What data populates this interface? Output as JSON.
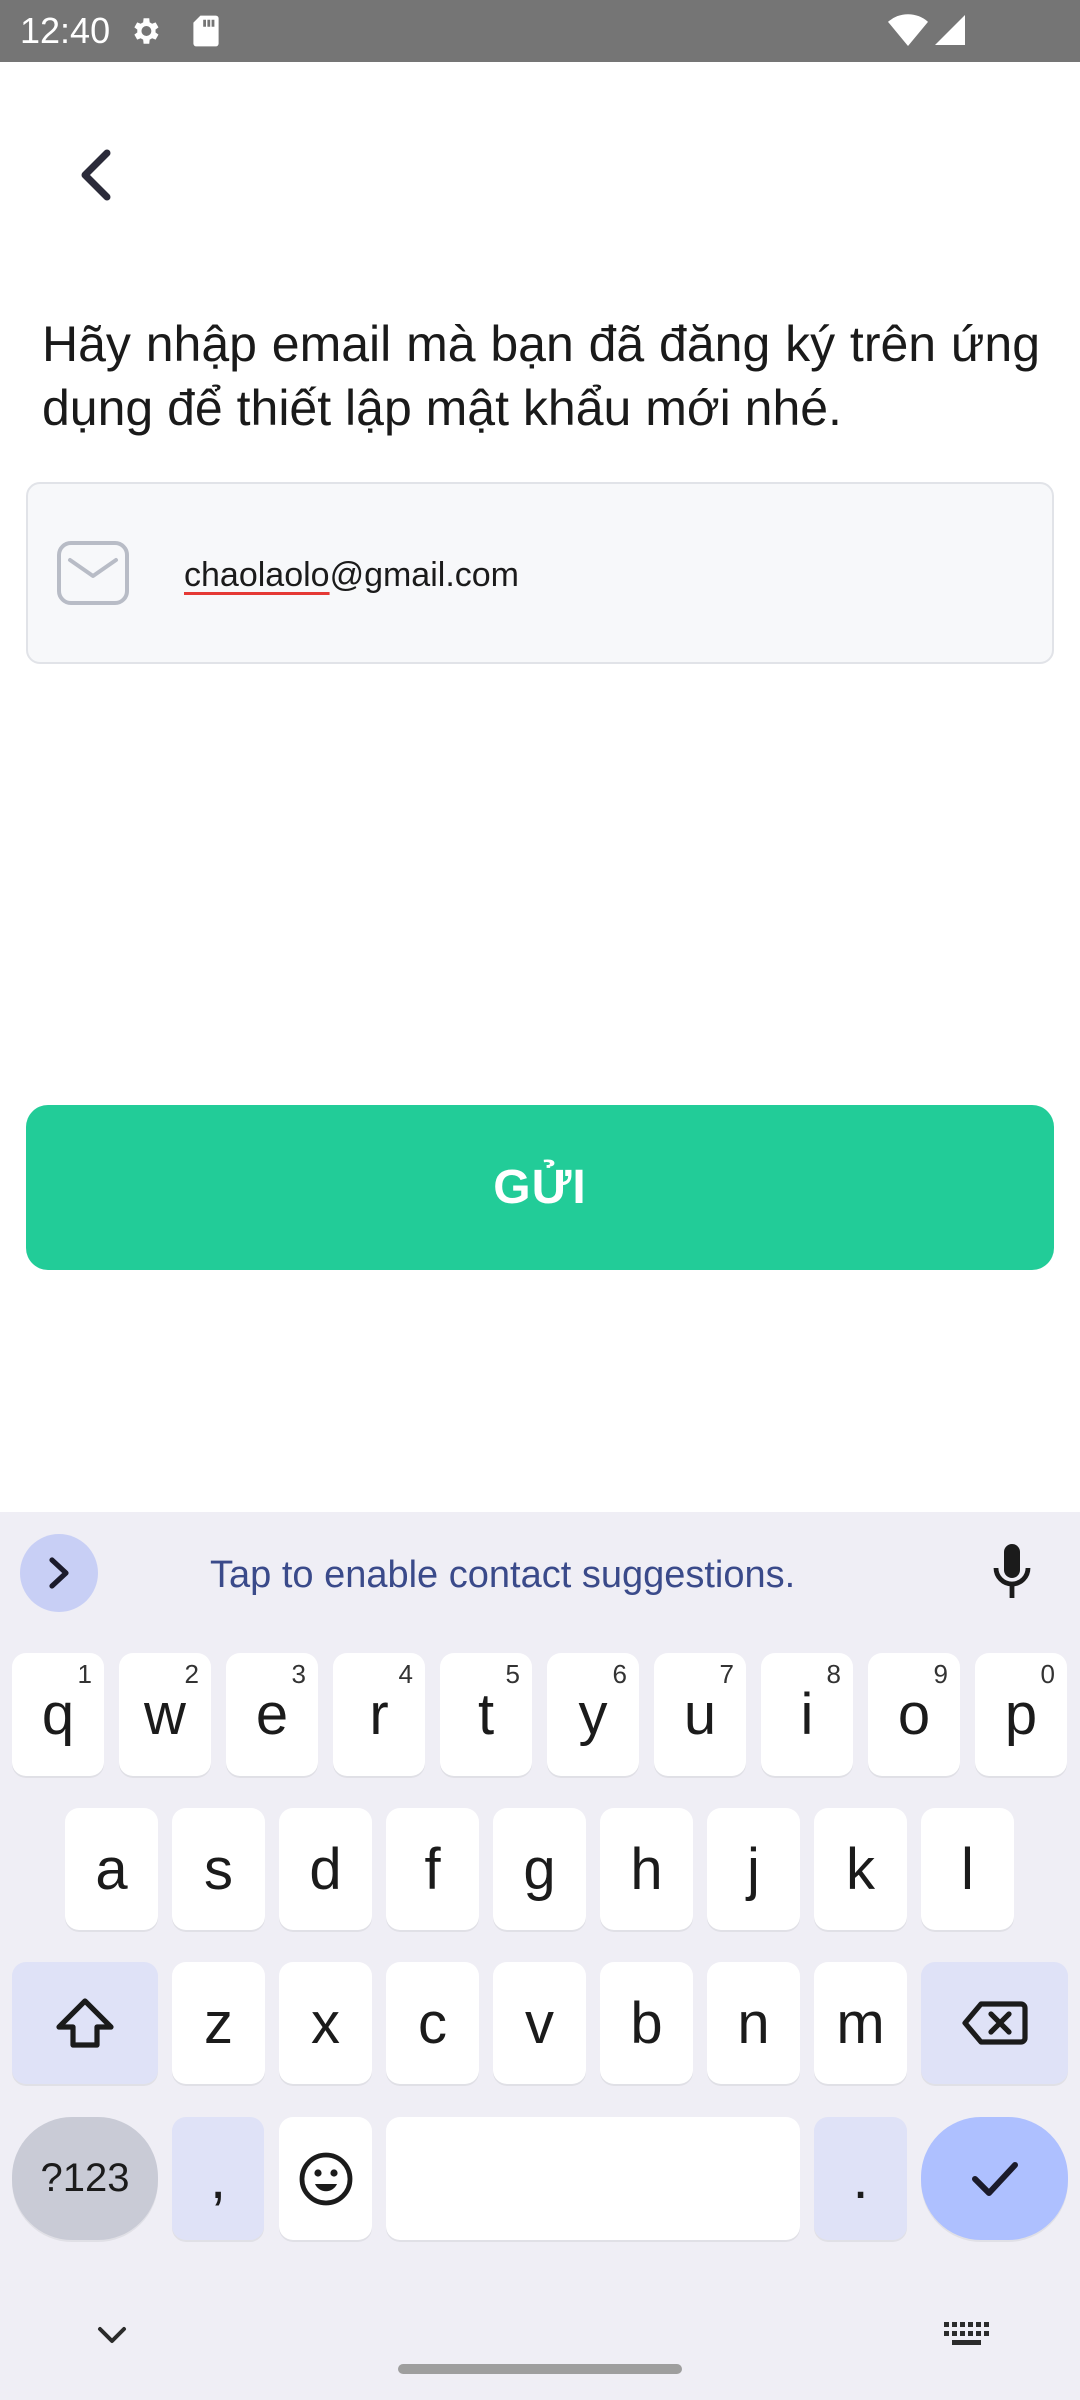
{
  "status_bar": {
    "time": "12:40",
    "icons": [
      "settings-icon",
      "sd-card-icon",
      "wifi-icon",
      "signal-icon"
    ]
  },
  "header": {
    "back_icon": "chevron-left-icon"
  },
  "instruction": "Hãy nhập email mà bạn đã đăng ký trên ứng dụng để thiết lập mật khẩu mới nhé.",
  "email_field": {
    "icon": "mail-icon",
    "value_misspelled": "chaolaolo",
    "value_rest": "@gmail.com"
  },
  "submit_button": {
    "label": "GỬI",
    "color": "#22cc98"
  },
  "keyboard": {
    "suggestion_text": "Tap to enable contact suggestions.",
    "row1": [
      {
        "k": "q",
        "h": "1"
      },
      {
        "k": "w",
        "h": "2"
      },
      {
        "k": "e",
        "h": "3"
      },
      {
        "k": "r",
        "h": "4"
      },
      {
        "k": "t",
        "h": "5"
      },
      {
        "k": "y",
        "h": "6"
      },
      {
        "k": "u",
        "h": "7"
      },
      {
        "k": "i",
        "h": "8"
      },
      {
        "k": "o",
        "h": "9"
      },
      {
        "k": "p",
        "h": "0"
      }
    ],
    "row2": [
      "a",
      "s",
      "d",
      "f",
      "g",
      "h",
      "j",
      "k",
      "l"
    ],
    "row3": [
      "z",
      "x",
      "c",
      "v",
      "b",
      "n",
      "m"
    ],
    "symbols_label": "?123",
    "comma": ",",
    "period": "."
  }
}
